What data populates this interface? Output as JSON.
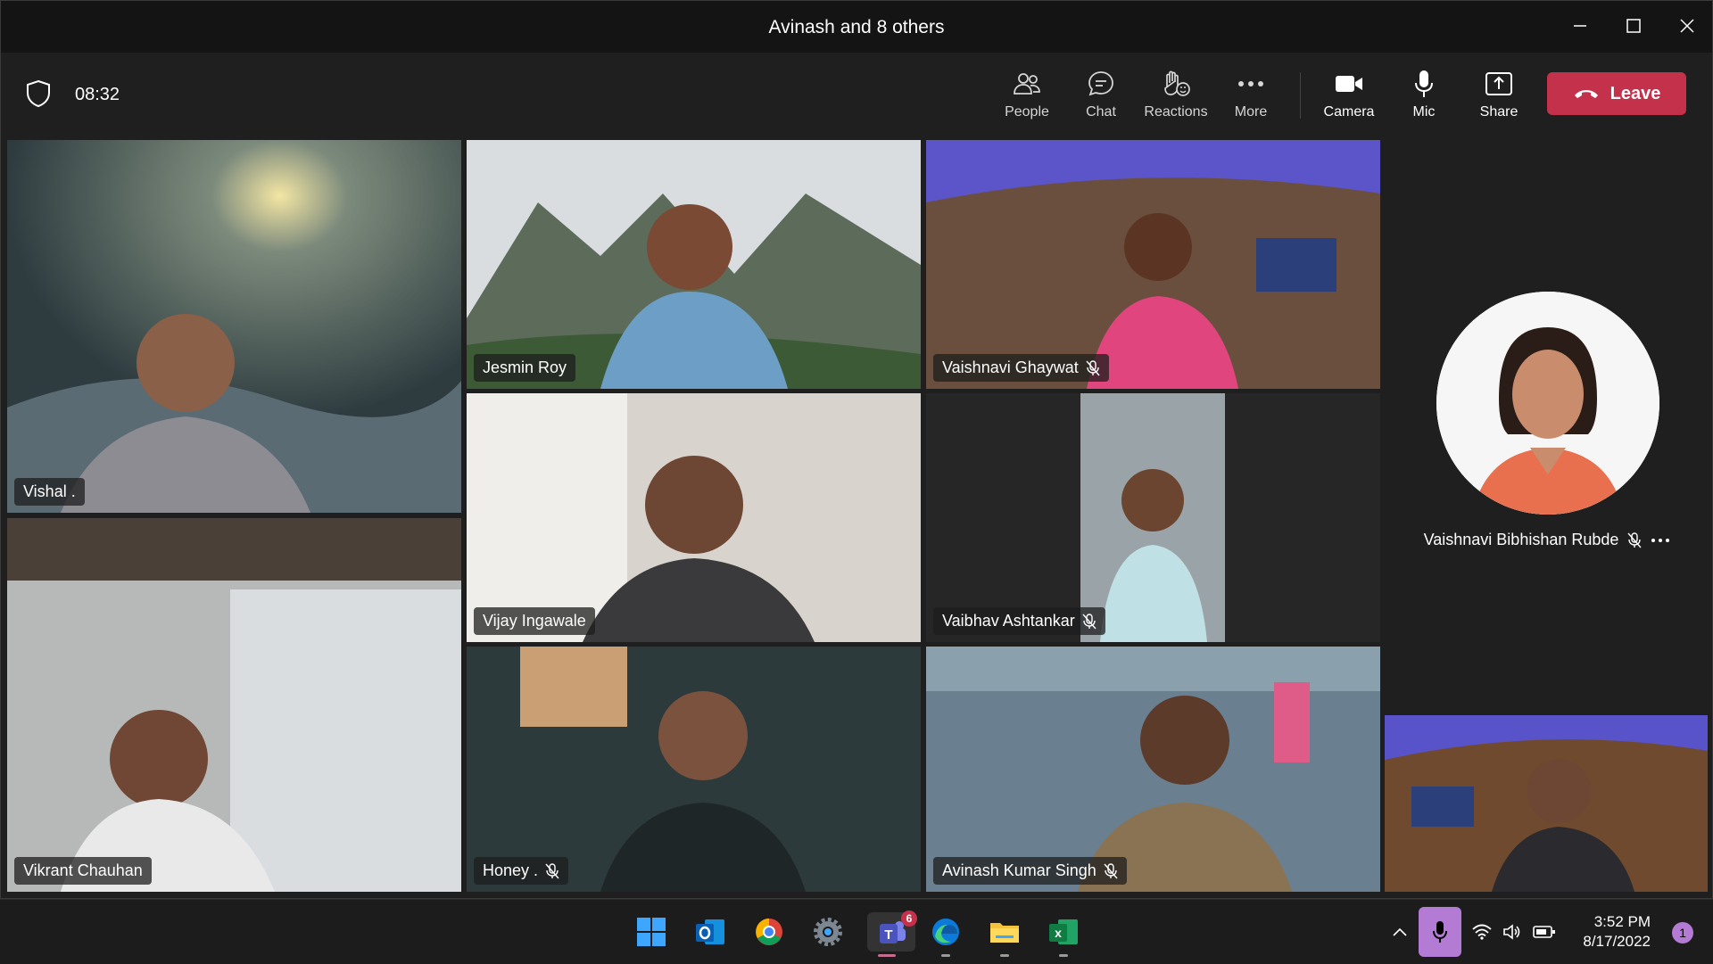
{
  "window": {
    "title": "Avinash and 8 others"
  },
  "toolbar": {
    "timer": "08:32",
    "buttons": {
      "people": "People",
      "chat": "Chat",
      "reactions": "Reactions",
      "more": "More",
      "camera": "Camera",
      "mic": "Mic",
      "share": "Share"
    },
    "leave": "Leave",
    "accent": "#c4314b"
  },
  "participants": {
    "vishal": "Vishal .",
    "jesmin": "Jesmin Roy",
    "vaishnavi_g": "Vaishnavi Ghaywat",
    "vijay": "Vijay Ingawale",
    "vaibhav": "Vaibhav Ashtankar",
    "vikrant": "Vikrant Chauhan",
    "honey": "Honey .",
    "avinash": "Avinash Kumar Singh",
    "vaishnavi_r": "Vaishnavi Bibhishan Rubde"
  },
  "active_speaker_color": "#7f85f5",
  "taskbar": {
    "apps": [
      "start-icon",
      "outlook-icon",
      "chrome-icon",
      "settings-icon",
      "teams-icon",
      "edge-icon",
      "file-explorer-icon",
      "excel-icon"
    ],
    "teams_badge": "6",
    "time": "3:52 PM",
    "date": "8/17/2022",
    "notification_count": "1"
  }
}
